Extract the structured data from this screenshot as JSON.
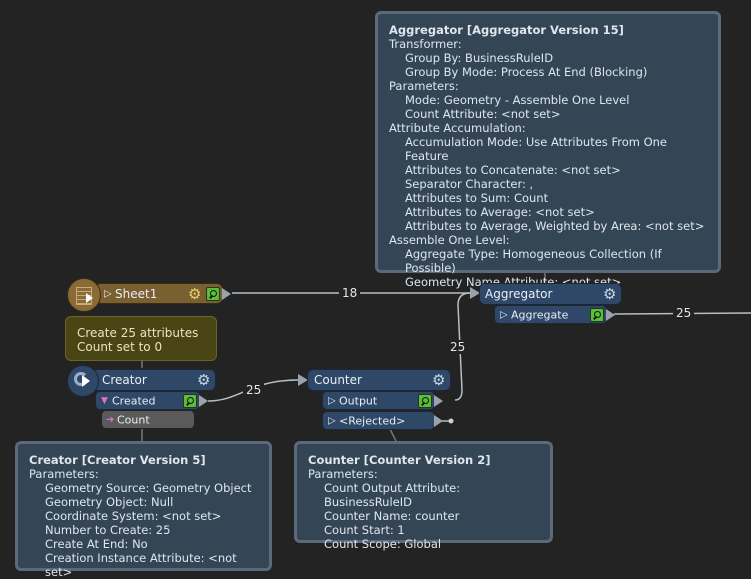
{
  "canvas": {
    "background": "#232323",
    "colors": {
      "transformer": "#2f4868",
      "reader": "#7a5f30",
      "annotation": "#4a4514",
      "tooltip": "#344556",
      "inspect": "#5bbd3a",
      "attribute": "#5a5a5a"
    }
  },
  "nodes": {
    "sheet1": {
      "label": "Sheet1",
      "icon": "spreadsheet-reader-icon",
      "port_icon": "play-outline-icon"
    },
    "creator": {
      "label": "Creator",
      "icon": "creator-icon",
      "output_port": "Created",
      "attribute": "Count"
    },
    "counter": {
      "label": "Counter",
      "output_port": "Output",
      "rejected_port": "<Rejected>"
    },
    "aggregator": {
      "label": "Aggregator",
      "output_port": "Aggregate"
    }
  },
  "annotation": {
    "lines": [
      "Create 25 attributes",
      "Count set to 0"
    ]
  },
  "connections": {
    "sheet1_to_aggregator": "18",
    "creator_to_counter": "25",
    "counter_to_aggregator": "25",
    "aggregator_out": "25"
  },
  "tooltips": {
    "aggregator": {
      "title": "Aggregator [Aggregator Version 15]",
      "lines": [
        {
          "text": "Transformer:",
          "indent": false
        },
        {
          "text": "Group By: BusinessRuleID",
          "indent": true
        },
        {
          "text": "Group By Mode: Process At End (Blocking)",
          "indent": true
        },
        {
          "text": "Parameters:",
          "indent": false
        },
        {
          "text": "Mode: Geometry - Assemble One Level",
          "indent": true
        },
        {
          "text": "Count Attribute: <not set>",
          "indent": true
        },
        {
          "text": "Attribute Accumulation:",
          "indent": false
        },
        {
          "text": "Accumulation Mode: Use Attributes From One Feature",
          "indent": true
        },
        {
          "text": "Attributes to Concatenate: <not set>",
          "indent": true
        },
        {
          "text": "Separator Character: ,",
          "indent": true
        },
        {
          "text": "Attributes to Sum: Count",
          "indent": true
        },
        {
          "text": "Attributes to Average: <not set>",
          "indent": true
        },
        {
          "text": "Attributes to Average, Weighted by Area: <not set>",
          "indent": true
        },
        {
          "text": "Assemble One Level:",
          "indent": false
        },
        {
          "text": "Aggregate Type: Homogeneous Collection (If Possible)",
          "indent": true
        },
        {
          "text": "Geometry Name Attribute: <not set>",
          "indent": true
        }
      ]
    },
    "creator": {
      "title": "Creator [Creator Version 5]",
      "lines": [
        {
          "text": "Parameters:",
          "indent": false
        },
        {
          "text": "Geometry Source: Geometry Object",
          "indent": true
        },
        {
          "text": "Geometry Object: Null",
          "indent": true
        },
        {
          "text": "Coordinate System: <not set>",
          "indent": true
        },
        {
          "text": "Number to Create: 25",
          "indent": true
        },
        {
          "text": "Create At End: No",
          "indent": true
        },
        {
          "text": "Creation Instance Attribute: <not set>",
          "indent": true
        }
      ]
    },
    "counter": {
      "title": "Counter [Counter Version 2]",
      "lines": [
        {
          "text": "Parameters:",
          "indent": false
        },
        {
          "text": "Count Output Attribute: BusinessRuleID",
          "indent": true
        },
        {
          "text": "Counter Name: counter",
          "indent": true
        },
        {
          "text": "Count Start: 1",
          "indent": true
        },
        {
          "text": "Count Scope: Global",
          "indent": true
        }
      ]
    }
  }
}
